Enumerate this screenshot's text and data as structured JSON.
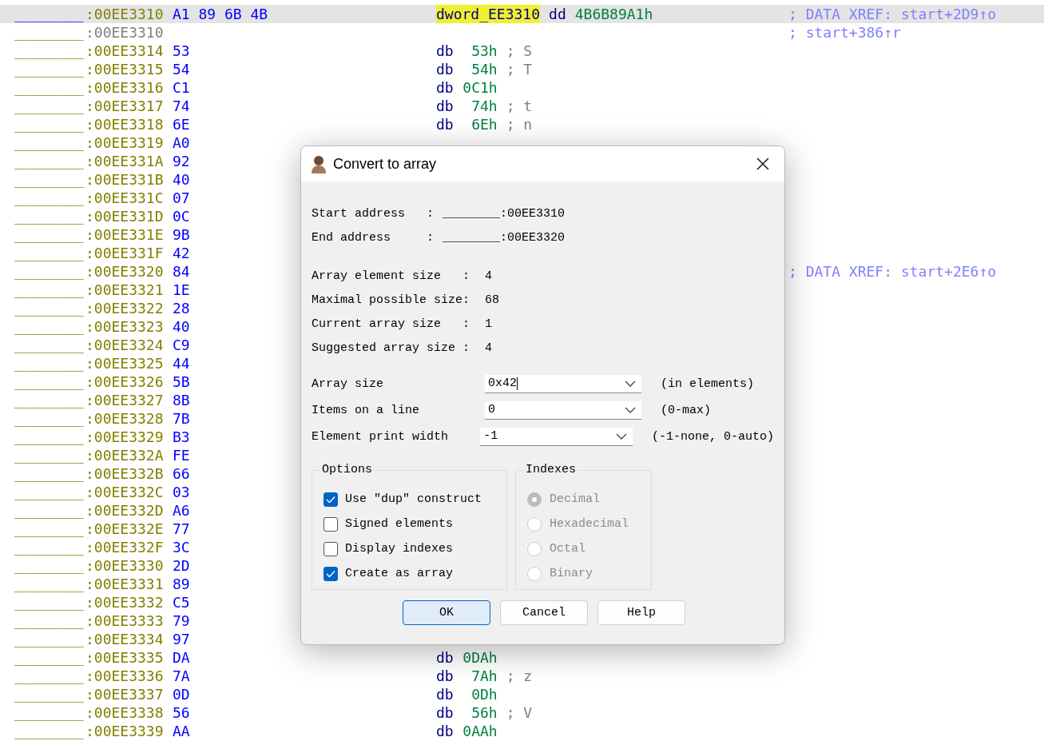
{
  "listing": [
    {
      "kind": "head",
      "selected": true,
      "segment": "________",
      "address": ":00EE3310",
      "bytes": "A1 89 6B 4B",
      "label": "dword_EE3310",
      "mnemonic": "dd",
      "operand": "4B6B89A1h",
      "xref": "; DATA XREF: start+2D9↑o"
    },
    {
      "kind": "continuation",
      "selected": false,
      "segment": "________",
      "address": ":00EE3310",
      "xref": "; start+386↑r"
    },
    {
      "kind": "byte",
      "selected": false,
      "segment": "________",
      "address": ":00EE3314",
      "bytes": "53",
      "mnemonic": "db",
      "operand": "53h",
      "char_comment": "; S"
    },
    {
      "kind": "byte",
      "selected": false,
      "segment": "________",
      "address": ":00EE3315",
      "bytes": "54",
      "mnemonic": "db",
      "operand": "54h",
      "char_comment": "; T"
    },
    {
      "kind": "byte",
      "selected": false,
      "segment": "________",
      "address": ":00EE3316",
      "bytes": "C1",
      "mnemonic": "db",
      "operand": "0C1h"
    },
    {
      "kind": "byte",
      "selected": false,
      "segment": "________",
      "address": ":00EE3317",
      "bytes": "74",
      "mnemonic": "db",
      "operand": "74h",
      "char_comment": "; t"
    },
    {
      "kind": "byte",
      "selected": false,
      "segment": "________",
      "address": ":00EE3318",
      "bytes": "6E",
      "mnemonic": "db",
      "operand": "6Eh",
      "char_comment": "; n"
    },
    {
      "kind": "byte",
      "selected": false,
      "segment": "________",
      "address": ":00EE3319",
      "bytes": "A0"
    },
    {
      "kind": "byte",
      "selected": false,
      "segment": "________",
      "address": ":00EE331A",
      "bytes": "92"
    },
    {
      "kind": "byte",
      "selected": false,
      "segment": "________",
      "address": ":00EE331B",
      "bytes": "40"
    },
    {
      "kind": "byte",
      "selected": false,
      "segment": "________",
      "address": ":00EE331C",
      "bytes": "07"
    },
    {
      "kind": "byte",
      "selected": false,
      "segment": "________",
      "address": ":00EE331D",
      "bytes": "0C"
    },
    {
      "kind": "byte",
      "selected": false,
      "segment": "________",
      "address": ":00EE331E",
      "bytes": "9B"
    },
    {
      "kind": "byte",
      "selected": false,
      "segment": "________",
      "address": ":00EE331F",
      "bytes": "42"
    },
    {
      "kind": "byte",
      "selected": false,
      "segment": "________",
      "address": ":00EE3320",
      "bytes": "84",
      "xref": "; DATA XREF: start+2E6↑o"
    },
    {
      "kind": "byte",
      "selected": false,
      "segment": "________",
      "address": ":00EE3321",
      "bytes": "1E"
    },
    {
      "kind": "byte",
      "selected": false,
      "segment": "________",
      "address": ":00EE3322",
      "bytes": "28"
    },
    {
      "kind": "byte",
      "selected": false,
      "segment": "________",
      "address": ":00EE3323",
      "bytes": "40"
    },
    {
      "kind": "byte",
      "selected": false,
      "segment": "________",
      "address": ":00EE3324",
      "bytes": "C9"
    },
    {
      "kind": "byte",
      "selected": false,
      "segment": "________",
      "address": ":00EE3325",
      "bytes": "44"
    },
    {
      "kind": "byte",
      "selected": false,
      "segment": "________",
      "address": ":00EE3326",
      "bytes": "5B"
    },
    {
      "kind": "byte",
      "selected": false,
      "segment": "________",
      "address": ":00EE3327",
      "bytes": "8B"
    },
    {
      "kind": "byte",
      "selected": false,
      "segment": "________",
      "address": ":00EE3328",
      "bytes": "7B"
    },
    {
      "kind": "byte",
      "selected": false,
      "segment": "________",
      "address": ":00EE3329",
      "bytes": "B3"
    },
    {
      "kind": "byte",
      "selected": false,
      "segment": "________",
      "address": ":00EE332A",
      "bytes": "FE"
    },
    {
      "kind": "byte",
      "selected": false,
      "segment": "________",
      "address": ":00EE332B",
      "bytes": "66"
    },
    {
      "kind": "byte",
      "selected": false,
      "segment": "________",
      "address": ":00EE332C",
      "bytes": "03"
    },
    {
      "kind": "byte",
      "selected": false,
      "segment": "________",
      "address": ":00EE332D",
      "bytes": "A6"
    },
    {
      "kind": "byte",
      "selected": false,
      "segment": "________",
      "address": ":00EE332E",
      "bytes": "77"
    },
    {
      "kind": "byte",
      "selected": false,
      "segment": "________",
      "address": ":00EE332F",
      "bytes": "3C"
    },
    {
      "kind": "byte",
      "selected": false,
      "segment": "________",
      "address": ":00EE3330",
      "bytes": "2D"
    },
    {
      "kind": "byte",
      "selected": false,
      "segment": "________",
      "address": ":00EE3331",
      "bytes": "89"
    },
    {
      "kind": "byte",
      "selected": false,
      "segment": "________",
      "address": ":00EE3332",
      "bytes": "C5"
    },
    {
      "kind": "byte",
      "selected": false,
      "segment": "________",
      "address": ":00EE3333",
      "bytes": "79"
    },
    {
      "kind": "byte",
      "selected": false,
      "segment": "________",
      "address": ":00EE3334",
      "bytes": "97"
    },
    {
      "kind": "byte",
      "selected": false,
      "segment": "________",
      "address": ":00EE3335",
      "bytes": "DA",
      "mnemonic": "db",
      "operand": "0DAh"
    },
    {
      "kind": "byte",
      "selected": false,
      "segment": "________",
      "address": ":00EE3336",
      "bytes": "7A",
      "mnemonic": "db",
      "operand": "7Ah",
      "char_comment": "; z"
    },
    {
      "kind": "byte",
      "selected": false,
      "segment": "________",
      "address": ":00EE3337",
      "bytes": "0D",
      "mnemonic": "db",
      "operand": "0Dh"
    },
    {
      "kind": "byte",
      "selected": false,
      "segment": "________",
      "address": ":00EE3338",
      "bytes": "56",
      "mnemonic": "db",
      "operand": "56h",
      "char_comment": "; V"
    },
    {
      "kind": "byte",
      "selected": false,
      "segment": "________",
      "address": ":00EE3339",
      "bytes": "AA",
      "mnemonic": "db",
      "operand": "0AAh"
    }
  ],
  "dialog": {
    "title": "Convert to array",
    "addresses": [
      {
        "label": "Start address   :",
        "value": "________:00EE3310"
      },
      {
        "label": "End address     :",
        "value": "________:00EE3320"
      }
    ],
    "sizes": [
      {
        "label": "Array element size   :",
        "value": "4"
      },
      {
        "label": "Maximal possible size:",
        "value": "68"
      },
      {
        "label": "Current array size   :",
        "value": "1"
      },
      {
        "label": "Suggested array size :",
        "value": "4"
      }
    ],
    "fields": [
      {
        "label": "Array size",
        "value": "0x42",
        "hint": "(in elements)",
        "focused": true
      },
      {
        "label": "Items on a line",
        "value": "0",
        "hint": "(0-max)",
        "focused": false
      },
      {
        "label": "Element print width",
        "value": "-1",
        "hint": "(-1-none, 0-auto)",
        "focused": false
      }
    ],
    "options": {
      "title": "Options",
      "items": [
        {
          "label": "Use \"dup\" construct",
          "checked": true
        },
        {
          "label": "Signed elements",
          "checked": false
        },
        {
          "label": "Display indexes",
          "checked": false
        },
        {
          "label": "Create as array",
          "checked": true
        }
      ]
    },
    "indexes": {
      "title": "Indexes",
      "items": [
        {
          "label": "Decimal",
          "selected": true,
          "disabled": true
        },
        {
          "label": "Hexadecimal",
          "selected": false,
          "disabled": true
        },
        {
          "label": "Octal",
          "selected": false,
          "disabled": true
        },
        {
          "label": "Binary",
          "selected": false,
          "disabled": true
        }
      ]
    },
    "buttons": [
      {
        "label": "OK",
        "default": true
      },
      {
        "label": "Cancel",
        "default": false
      },
      {
        "label": "Help",
        "default": false
      }
    ]
  }
}
